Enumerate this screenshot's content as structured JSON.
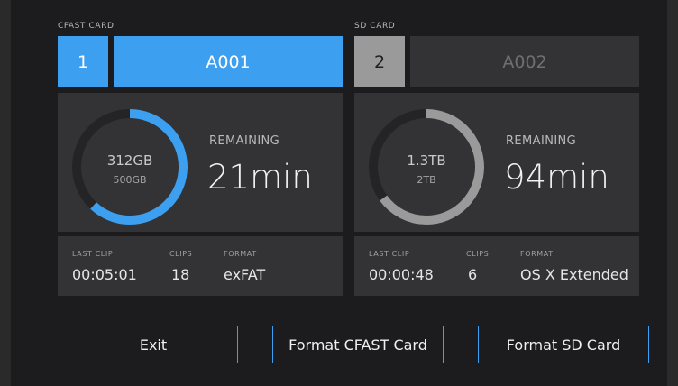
{
  "cfast": {
    "label": "CFAST CARD",
    "slot": "1",
    "reel": "A001",
    "used": "312GB",
    "total": "500GB",
    "fill_fraction": 0.62,
    "remaining_label": "REMAINING",
    "remaining": "21min",
    "last_clip_label": "LAST CLIP",
    "last_clip": "00:05:01",
    "clips_label": "CLIPS",
    "clips": "18",
    "format_label": "FORMAT",
    "format": "exFAT",
    "accent": "#3c9ff0"
  },
  "sd": {
    "label": "SD CARD",
    "slot": "2",
    "reel": "A002",
    "used": "1.3TB",
    "total": "2TB",
    "fill_fraction": 0.65,
    "remaining_label": "REMAINING",
    "remaining": "94min",
    "last_clip_label": "LAST CLIP",
    "last_clip": "00:00:48",
    "clips_label": "CLIPS",
    "clips": "6",
    "format_label": "FORMAT",
    "format": "OS X Extended",
    "accent": "#9a9a9a"
  },
  "buttons": {
    "exit": "Exit",
    "format_cfast": "Format CFAST Card",
    "format_sd": "Format SD Card"
  }
}
